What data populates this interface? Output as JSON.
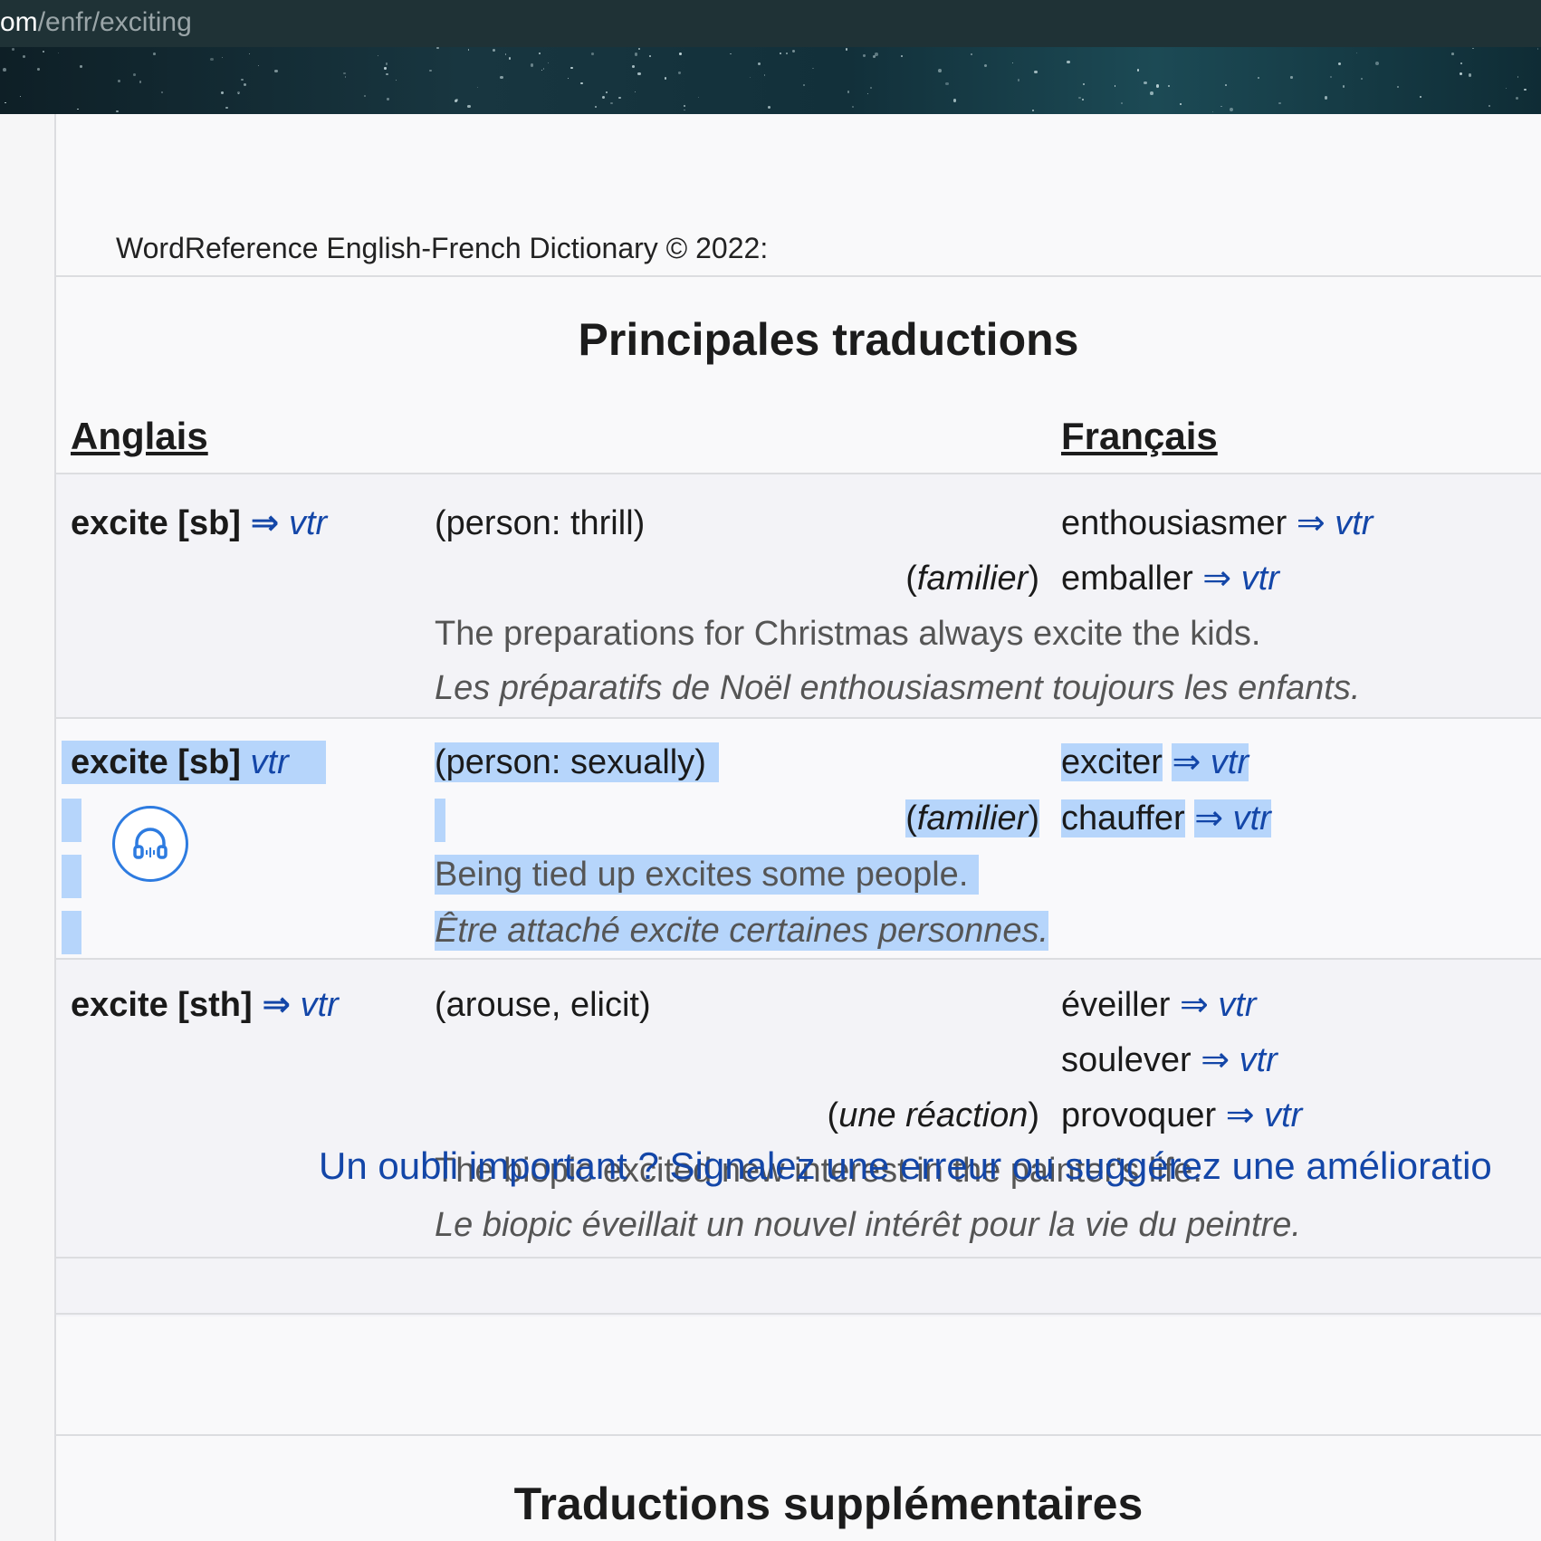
{
  "browser": {
    "url_prefix": "om",
    "url_path": "/enfr/exciting"
  },
  "header": {
    "copyright": "WordReference English-French Dictionary © 2022:"
  },
  "main_section": {
    "title": "Principales traductions",
    "col_english": "Anglais",
    "col_french": "Français"
  },
  "entries": [
    {
      "headword": "excite [sb]",
      "arrow": "⇒",
      "pos": "vtr",
      "sense": "(person: thrill)",
      "translations": [
        {
          "note": "",
          "word": "enthousiasmer",
          "arrow": "⇒",
          "pos": "vtr"
        },
        {
          "note_open": "(",
          "note": "familier",
          "note_close": ")",
          "word": "emballer",
          "arrow": "⇒",
          "pos": "vtr"
        }
      ],
      "example_en": "The preparations for Christmas always excite the kids.",
      "example_fr": "Les préparatifs de Noël enthousiasment toujours les enfants."
    },
    {
      "headword": "excite [sb]",
      "pos": "vtr",
      "sense": "(person: sexually)",
      "translations": [
        {
          "note": "",
          "word": "exciter",
          "arrow": "⇒",
          "pos": "vtr"
        },
        {
          "note_open": "(",
          "note": "familier",
          "note_close": ")",
          "word": "chauffer",
          "arrow": "⇒",
          "pos": "vtr"
        }
      ],
      "example_en": "Being tied up excites some people.",
      "example_fr": "Être attaché excite certaines personnes."
    },
    {
      "headword": "excite [sth]",
      "arrow": "⇒",
      "pos": "vtr",
      "sense": "(arouse, elicit)",
      "translations": [
        {
          "note": "",
          "word": "éveiller",
          "arrow": "⇒",
          "pos": "vtr"
        },
        {
          "note": "",
          "word": "soulever",
          "arrow": "⇒",
          "pos": "vtr"
        },
        {
          "note_open": "(",
          "note": "une réaction",
          "note_close": ")",
          "word": "provoquer",
          "arrow": "⇒",
          "pos": "vtr"
        }
      ],
      "example_en": "The biopic excited new interest in the painter's life.",
      "example_fr": "Le biopic éveillait un nouvel intérêt pour la vie du peintre."
    }
  ],
  "report_link": "Un oubli important ? Signalez une erreur ou suggérez une amélioratio",
  "additional_section": {
    "title": "Traductions supplémentaires"
  },
  "icons": {
    "listen": "headphones-icon"
  },
  "colors": {
    "link_blue": "#1346a8",
    "selection": "#b6d5fb",
    "url_bar": "#1f3236"
  }
}
